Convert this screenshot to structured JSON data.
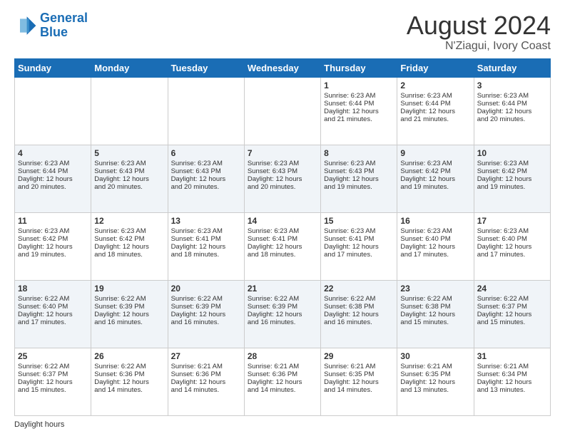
{
  "header": {
    "logo_line1": "General",
    "logo_line2": "Blue",
    "month_title": "August 2024",
    "location": "N'Ziagui, Ivory Coast"
  },
  "days_of_week": [
    "Sunday",
    "Monday",
    "Tuesday",
    "Wednesday",
    "Thursday",
    "Friday",
    "Saturday"
  ],
  "weeks": [
    [
      {
        "day": "",
        "info": ""
      },
      {
        "day": "",
        "info": ""
      },
      {
        "day": "",
        "info": ""
      },
      {
        "day": "",
        "info": ""
      },
      {
        "day": "1",
        "info": "Sunrise: 6:23 AM\nSunset: 6:44 PM\nDaylight: 12 hours\nand 21 minutes."
      },
      {
        "day": "2",
        "info": "Sunrise: 6:23 AM\nSunset: 6:44 PM\nDaylight: 12 hours\nand 21 minutes."
      },
      {
        "day": "3",
        "info": "Sunrise: 6:23 AM\nSunset: 6:44 PM\nDaylight: 12 hours\nand 20 minutes."
      }
    ],
    [
      {
        "day": "4",
        "info": "Sunrise: 6:23 AM\nSunset: 6:44 PM\nDaylight: 12 hours\nand 20 minutes."
      },
      {
        "day": "5",
        "info": "Sunrise: 6:23 AM\nSunset: 6:43 PM\nDaylight: 12 hours\nand 20 minutes."
      },
      {
        "day": "6",
        "info": "Sunrise: 6:23 AM\nSunset: 6:43 PM\nDaylight: 12 hours\nand 20 minutes."
      },
      {
        "day": "7",
        "info": "Sunrise: 6:23 AM\nSunset: 6:43 PM\nDaylight: 12 hours\nand 20 minutes."
      },
      {
        "day": "8",
        "info": "Sunrise: 6:23 AM\nSunset: 6:43 PM\nDaylight: 12 hours\nand 19 minutes."
      },
      {
        "day": "9",
        "info": "Sunrise: 6:23 AM\nSunset: 6:42 PM\nDaylight: 12 hours\nand 19 minutes."
      },
      {
        "day": "10",
        "info": "Sunrise: 6:23 AM\nSunset: 6:42 PM\nDaylight: 12 hours\nand 19 minutes."
      }
    ],
    [
      {
        "day": "11",
        "info": "Sunrise: 6:23 AM\nSunset: 6:42 PM\nDaylight: 12 hours\nand 19 minutes."
      },
      {
        "day": "12",
        "info": "Sunrise: 6:23 AM\nSunset: 6:42 PM\nDaylight: 12 hours\nand 18 minutes."
      },
      {
        "day": "13",
        "info": "Sunrise: 6:23 AM\nSunset: 6:41 PM\nDaylight: 12 hours\nand 18 minutes."
      },
      {
        "day": "14",
        "info": "Sunrise: 6:23 AM\nSunset: 6:41 PM\nDaylight: 12 hours\nand 18 minutes."
      },
      {
        "day": "15",
        "info": "Sunrise: 6:23 AM\nSunset: 6:41 PM\nDaylight: 12 hours\nand 17 minutes."
      },
      {
        "day": "16",
        "info": "Sunrise: 6:23 AM\nSunset: 6:40 PM\nDaylight: 12 hours\nand 17 minutes."
      },
      {
        "day": "17",
        "info": "Sunrise: 6:23 AM\nSunset: 6:40 PM\nDaylight: 12 hours\nand 17 minutes."
      }
    ],
    [
      {
        "day": "18",
        "info": "Sunrise: 6:22 AM\nSunset: 6:40 PM\nDaylight: 12 hours\nand 17 minutes."
      },
      {
        "day": "19",
        "info": "Sunrise: 6:22 AM\nSunset: 6:39 PM\nDaylight: 12 hours\nand 16 minutes."
      },
      {
        "day": "20",
        "info": "Sunrise: 6:22 AM\nSunset: 6:39 PM\nDaylight: 12 hours\nand 16 minutes."
      },
      {
        "day": "21",
        "info": "Sunrise: 6:22 AM\nSunset: 6:39 PM\nDaylight: 12 hours\nand 16 minutes."
      },
      {
        "day": "22",
        "info": "Sunrise: 6:22 AM\nSunset: 6:38 PM\nDaylight: 12 hours\nand 16 minutes."
      },
      {
        "day": "23",
        "info": "Sunrise: 6:22 AM\nSunset: 6:38 PM\nDaylight: 12 hours\nand 15 minutes."
      },
      {
        "day": "24",
        "info": "Sunrise: 6:22 AM\nSunset: 6:37 PM\nDaylight: 12 hours\nand 15 minutes."
      }
    ],
    [
      {
        "day": "25",
        "info": "Sunrise: 6:22 AM\nSunset: 6:37 PM\nDaylight: 12 hours\nand 15 minutes."
      },
      {
        "day": "26",
        "info": "Sunrise: 6:22 AM\nSunset: 6:36 PM\nDaylight: 12 hours\nand 14 minutes."
      },
      {
        "day": "27",
        "info": "Sunrise: 6:21 AM\nSunset: 6:36 PM\nDaylight: 12 hours\nand 14 minutes."
      },
      {
        "day": "28",
        "info": "Sunrise: 6:21 AM\nSunset: 6:36 PM\nDaylight: 12 hours\nand 14 minutes."
      },
      {
        "day": "29",
        "info": "Sunrise: 6:21 AM\nSunset: 6:35 PM\nDaylight: 12 hours\nand 14 minutes."
      },
      {
        "day": "30",
        "info": "Sunrise: 6:21 AM\nSunset: 6:35 PM\nDaylight: 12 hours\nand 13 minutes."
      },
      {
        "day": "31",
        "info": "Sunrise: 6:21 AM\nSunset: 6:34 PM\nDaylight: 12 hours\nand 13 minutes."
      }
    ]
  ],
  "footer": {
    "label": "Daylight hours"
  }
}
